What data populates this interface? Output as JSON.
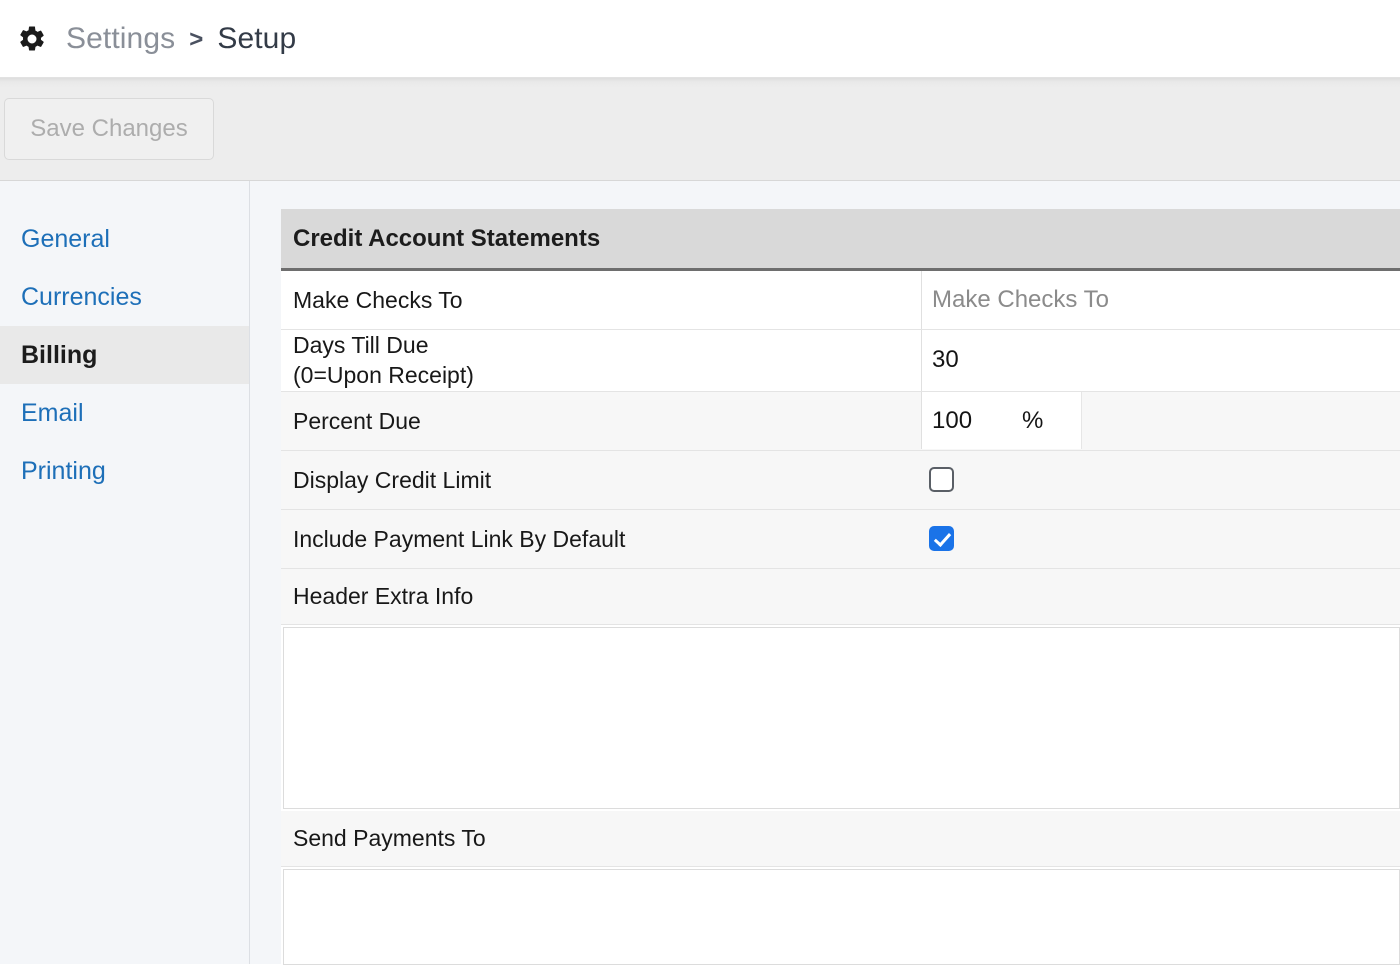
{
  "header": {
    "icon": "gear-icon",
    "parent_crumb": "Settings",
    "separator": ">",
    "current_crumb": "Setup"
  },
  "toolbar": {
    "save_label": "Save Changes",
    "save_enabled": false
  },
  "sidebar": {
    "items": [
      {
        "label": "General",
        "active": false
      },
      {
        "label": "Currencies",
        "active": false
      },
      {
        "label": "Billing",
        "active": true
      },
      {
        "label": "Email",
        "active": false
      },
      {
        "label": "Printing",
        "active": false
      }
    ]
  },
  "panel": {
    "title": "Credit Account Statements",
    "rows": {
      "make_checks_to": {
        "label": "Make Checks To",
        "value": "",
        "placeholder": "Make Checks To"
      },
      "days_till_due": {
        "label": "Days Till Due",
        "sublabel": "(0=Upon Receipt)",
        "value": "30",
        "placeholder": ""
      },
      "percent_due": {
        "label": "Percent Due",
        "value": "100",
        "suffix": "%",
        "placeholder": ""
      },
      "display_credit_limit": {
        "label": "Display Credit Limit",
        "checked": false
      },
      "include_payment_link": {
        "label": "Include Payment Link By Default",
        "checked": true
      },
      "header_extra_info": {
        "label": "Header Extra Info",
        "value": "",
        "placeholder": ""
      },
      "send_payments_to": {
        "label": "Send Payments To",
        "value": "",
        "placeholder": ""
      }
    }
  },
  "colors": {
    "link": "#1d6fb8",
    "accent_checked": "#1a73e8",
    "panel_header_bg": "#d9d9d9",
    "row_bg": "#f7f7f7",
    "app_bg": "#f4f6f9"
  }
}
